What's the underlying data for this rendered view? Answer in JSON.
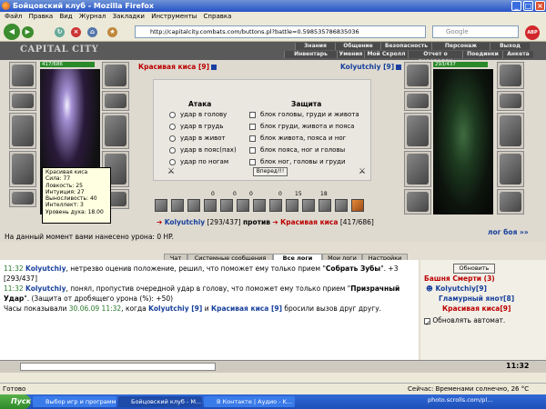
{
  "window": {
    "title": "Бойцовский клуб - Mozilla Firefox"
  },
  "menu": [
    "Файл",
    "Правка",
    "Вид",
    "Журнал",
    "Закладки",
    "Инструменты",
    "Справка"
  ],
  "address": {
    "url": "http://capitalcity.combats.com/buttons.pl?battle=0.598535786835036"
  },
  "search": {
    "placeholder": "Google"
  },
  "game": {
    "logo": "CAPITAL CITY",
    "top_tabs": [
      "Знания",
      "Общение",
      "Безопасность",
      "Персонаж",
      "Выход"
    ],
    "sub_tabs": [
      "Инвентарь",
      "Умения",
      "Мой Скролл",
      "Отчет о переводах",
      "Поединки",
      "Анкета"
    ],
    "player": {
      "name": "Kolyutchiy",
      "level": "[9]",
      "hp": "417/686"
    },
    "enemy": {
      "name": "Красивая киса",
      "level": "[9]",
      "hp": "293/437"
    },
    "tooltip": {
      "name": "Красивая киса",
      "lines": [
        "Сила: 77",
        "Ловкость: 25",
        "Интуиция: 27",
        "Выносливость: 40",
        "Интеллект: 3"
      ],
      "spirit": "Уровень духа: 18.00"
    },
    "attack": {
      "header": "Атака",
      "options": [
        "удар в голову",
        "удар в грудь",
        "удар в живот",
        "удар в пояс(пах)",
        "удар по ногам"
      ]
    },
    "defense": {
      "header": "Защита",
      "options": [
        "блок головы, груди и живота",
        "блок груди, живота и пояса",
        "блок живота, пояса и ног",
        "блок пояса, ног и головы",
        "блок ног, головы и груди"
      ]
    },
    "forward_btn": "Вперед!!!",
    "stats": [
      "0",
      "0",
      "0",
      "0",
      "15",
      "18"
    ],
    "versus": {
      "p1": "Kolyutchiy",
      "p1hp": "[293/437]",
      "word": "против",
      "p2": "Красивая киса",
      "p2hp": "[417/686]"
    },
    "fight_log_link": "лог боя »»",
    "damage": "На данный момент вами нанесено урона: 0 HP."
  },
  "tabs": [
    "Чат",
    "Системные сообщения",
    "Все логи",
    "Мои логи",
    "Настройки"
  ],
  "log": {
    "l1_time": "11:32",
    "l1_name": "Kolyutchiy",
    "l1_text": ", нетрезво оценив положение, решил, что поможет ему только прием \"",
    "l1_skill": "Собрать Зубы",
    "l1_tail": "\". +3 [293/437]",
    "l2_time": "11:32",
    "l2_name": "Kolyutchiy",
    "l2_text": ", понял, пропустив очередной удар в голову, что поможет ему только прием \"",
    "l2_skill": "Призрачный Удар",
    "l2_tail": "\". (Защита от дробящего урона (%): +50)",
    "l3_a": "Часы показывали ",
    "l3_date": "30.06.09 11:32",
    "l3_b": ", когда ",
    "l3_n1": "Kolyutchiy [9]",
    "l3_c": " и ",
    "l3_n2": "Красивая киса [9]",
    "l3_d": " бросили вызов друг другу."
  },
  "right": {
    "refresh": "Обновить",
    "tower": "Башня Смерти (3)",
    "players": [
      "Kolyutchiy[9]",
      "Гламурный янот[8]",
      "Красивая киса[9]"
    ],
    "auto": "Обновлять автомат.",
    "clock": "11:32"
  },
  "status": {
    "left": "Готово",
    "weather": "Сейчас: Временами солнечно, 26 °C"
  },
  "taskbar": {
    "start": "Пуск",
    "tasks": [
      "Выбор игр и программ",
      "Бойцовский клуб - M...",
      "В Контакте | Аудио - K..."
    ],
    "watermark": "photo.scrolls.com/pl..."
  }
}
